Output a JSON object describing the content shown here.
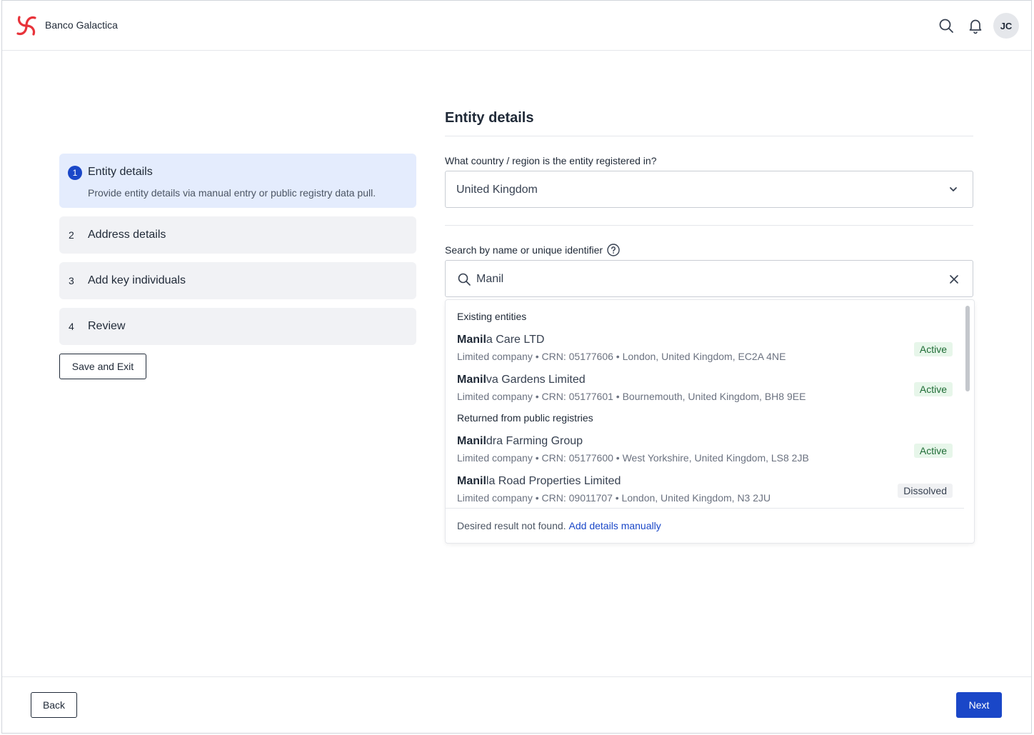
{
  "header": {
    "brand": "Banco Galactica",
    "avatar_initials": "JC",
    "icons": [
      "logo-icon",
      "search-icon",
      "bell-icon"
    ],
    "accent_color": "#e8333a"
  },
  "stepper": {
    "steps": [
      {
        "number": "1",
        "title": "Entity details",
        "description": "Provide entity details via manual entry or public registry data pull.",
        "active": true
      },
      {
        "number": "2",
        "title": "Address details"
      },
      {
        "number": "3",
        "title": "Add key individuals"
      },
      {
        "number": "4",
        "title": "Review"
      }
    ],
    "save_exit_label": "Save and Exit"
  },
  "form": {
    "title": "Entity details",
    "country": {
      "label": "What country / region is the entity registered in?",
      "value": "United Kingdom"
    },
    "search": {
      "label": "Search by name or unique identifier",
      "value": "Manil"
    }
  },
  "results": {
    "existing_heading": "Existing entities",
    "registry_heading": "Returned from public registries",
    "existing": [
      {
        "match": "Manil",
        "rest": "a Care LTD",
        "meta": "Limited company • CRN: 05177606 • London, United Kingdom, EC2A 4NE",
        "status": "Active"
      },
      {
        "match": "Manil",
        "rest": "va Gardens Limited",
        "meta": "Limited company • CRN: 05177601 • Bournemouth, United Kingdom, BH8 9EE",
        "status": "Active"
      }
    ],
    "registry": [
      {
        "match": "Manil",
        "rest": "dra Farming Group",
        "meta": "Limited company • CRN: 05177600 • West Yorkshire, United Kingdom, LS8 2JB",
        "status": "Active"
      },
      {
        "match": "Manil",
        "rest": "la Road Properties Limited",
        "meta": "Limited company • CRN: 09011707 • London, United Kingdom, N3 2JU",
        "status": "Dissolved"
      }
    ],
    "footer_text": "Desired result not found.",
    "footer_link": "Add details manually"
  },
  "footer": {
    "back_label": "Back",
    "next_label": "Next",
    "primary_color": "#1a47c8"
  }
}
